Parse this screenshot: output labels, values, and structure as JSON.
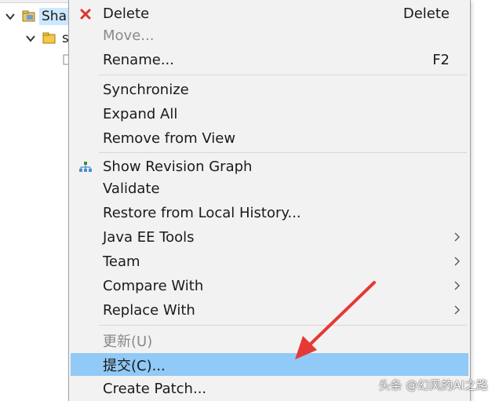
{
  "tree": {
    "items": [
      {
        "label": "Sha"
      },
      {
        "label": "s"
      }
    ]
  },
  "menu": {
    "items": [
      {
        "label": "Delete",
        "accel": "Delete",
        "icon": "delete-x-icon"
      },
      {
        "label": "Move...",
        "disabled": true
      },
      {
        "label": "Rename...",
        "accel": "F2"
      },
      {
        "label": "Synchronize"
      },
      {
        "label": "Expand All"
      },
      {
        "label": "Remove from View"
      },
      {
        "label": "Show Revision Graph",
        "icon": "revision-graph-icon"
      },
      {
        "label": "Validate"
      },
      {
        "label": "Restore from Local History..."
      },
      {
        "label": "Java EE Tools",
        "submenu": true
      },
      {
        "label": "Team",
        "submenu": true
      },
      {
        "label": "Compare With",
        "submenu": true
      },
      {
        "label": "Replace With",
        "submenu": true
      },
      {
        "label": "更新(U)",
        "disabled": true
      },
      {
        "label": "提交(C)...",
        "highlighted": true
      },
      {
        "label": "Create Patch..."
      }
    ]
  },
  "watermark": "头条 @幻风的AI之路",
  "colors": {
    "menu_bg": "#f2f2f2",
    "highlight": "#91c9f7",
    "arrow_red": "#e53935",
    "delete_red": "#d9352b"
  }
}
